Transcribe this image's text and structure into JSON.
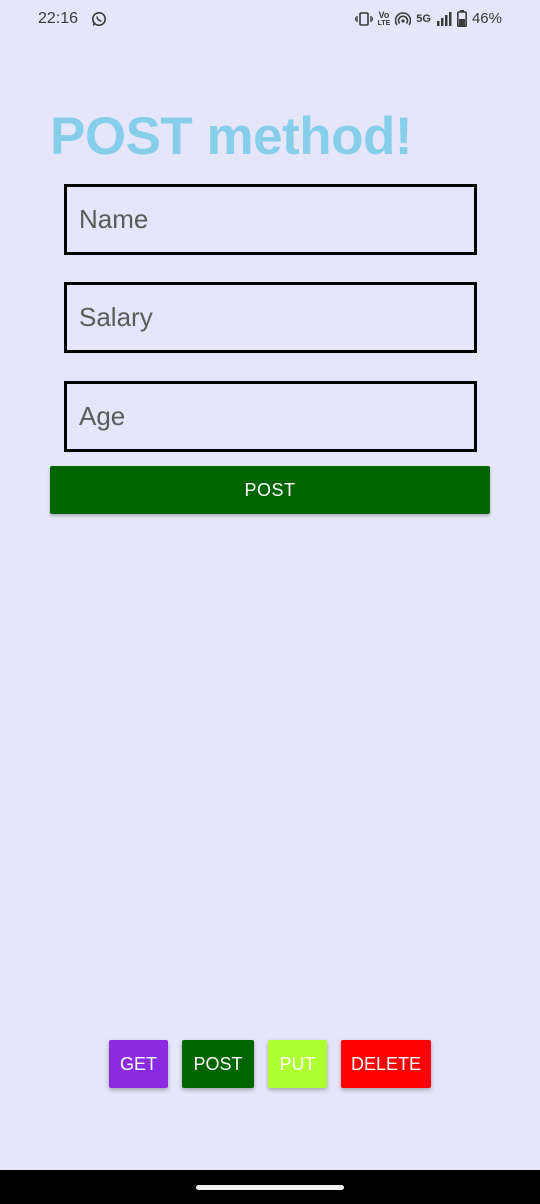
{
  "status_bar": {
    "time": "22:16",
    "volte_label_top": "Vo",
    "volte_label_bottom": "LTE",
    "network": "5G",
    "battery": "46%",
    "icons": [
      "whatsapp-icon",
      "vibrate-icon",
      "volte-icon",
      "hotspot-icon",
      "signal-icon",
      "battery-icon"
    ]
  },
  "page": {
    "title": "POST method!",
    "title_color": "#87CEEB",
    "background": "#E6E6FA"
  },
  "form": {
    "name_placeholder": "Name",
    "salary_placeholder": "Salary",
    "age_placeholder": "Age",
    "submit_label": "POST",
    "submit_color": "#006400"
  },
  "nav_buttons": {
    "get": {
      "label": "GET",
      "color": "#8A2BE2"
    },
    "post": {
      "label": "POST",
      "color": "#006400"
    },
    "put": {
      "label": "PUT",
      "color": "#ADFF2F"
    },
    "delete": {
      "label": "DELETE",
      "color": "#FF0000"
    }
  }
}
